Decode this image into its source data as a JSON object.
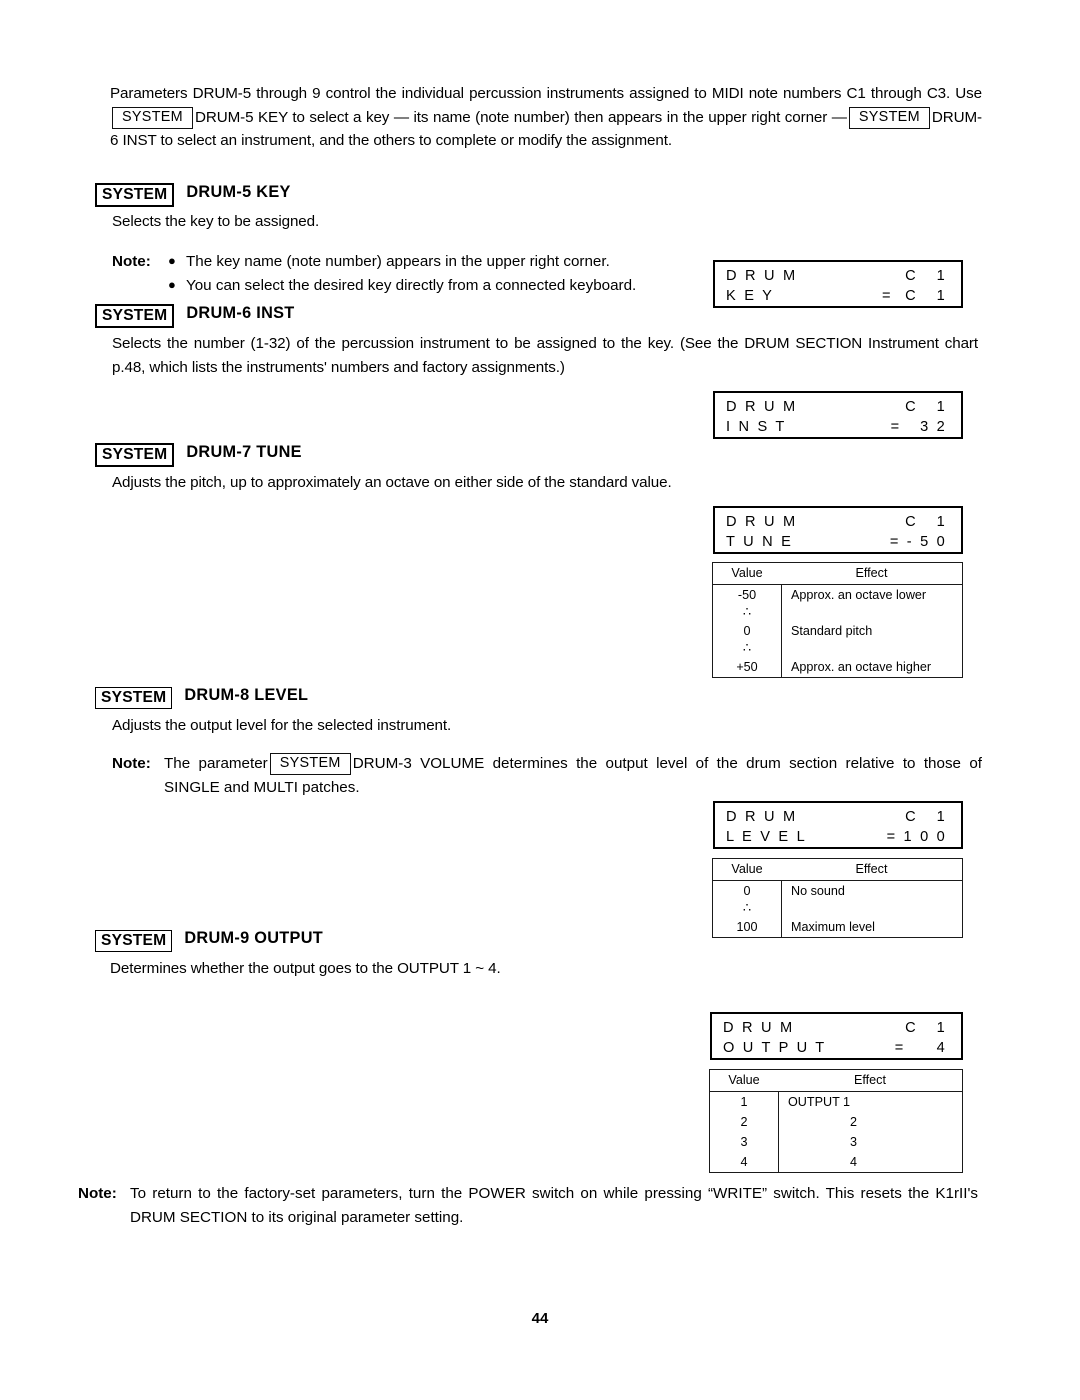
{
  "page": {
    "number": "44"
  },
  "intro": {
    "seg1": "Parameters DRUM-5 through 9 control the individual percussion instruments assigned to MIDI note numbers C1 through C3. Use",
    "sys1": "SYSTEM",
    "seg2": "DRUM-5 KEY to select a key — its name (note number) then appears in the upper right corner —",
    "sys2": "SYSTEM",
    "seg3": "DRUM-6 INST to select an instrument, and the others to complete or modify the assignment."
  },
  "sections": [
    {
      "key_label": "SYSTEM",
      "title": "DRUM-5 KEY",
      "body": "Selects the key to be assigned.",
      "note_label": "Note:",
      "bullets": [
        "The key name (note number) appears in the upper right corner.",
        "You can select the desired key directly from a connected keyboard."
      ],
      "lcd": {
        "line1_left": "D R U M",
        "line1_right": "C   1",
        "line2_left": "K E Y",
        "line2_right": "=  C   1"
      }
    },
    {
      "key_label": "SYSTEM",
      "title": "DRUM-6 INST",
      "body": "Selects the number (1-32) of the percussion instrument to be assigned to the key. (See the DRUM SECTION Instrument chart p.48, which lists the instruments' numbers and factory assignments.)",
      "lcd": {
        "line1_left": "D R U M",
        "line1_right": "C   1",
        "line2_left": "I N S T",
        "line2_right": "=   3 2"
      }
    },
    {
      "key_label": "SYSTEM",
      "title": "DRUM-7 TUNE",
      "body": "Adjusts the pitch, up to approximately an octave on either side of the standard value.",
      "lcd": {
        "line1_left": "D R U M",
        "line1_right": "C   1",
        "line2_left": "T U N E",
        "line2_right": "= - 5 0"
      },
      "table": {
        "headers": [
          "Value",
          "Effect"
        ],
        "rows": [
          {
            "value": "-50",
            "effect": "Approx. an octave lower",
            "cont": false
          },
          {
            "value": "∴",
            "effect": "",
            "cont": true
          },
          {
            "value": "0",
            "effect": "Standard pitch",
            "cont": false
          },
          {
            "value": "∴",
            "effect": "",
            "cont": true
          },
          {
            "value": "+50",
            "effect": "Approx. an octave higher",
            "cont": false
          }
        ]
      }
    },
    {
      "key_label": "SYSTEM",
      "title": "DRUM-8 LEVEL",
      "body": "Adjusts the output level for the selected instrument.",
      "note_label": "Note:",
      "note_seg1": "The parameter",
      "note_sys": "SYSTEM",
      "note_seg2": "DRUM-3 VOLUME determines the output level of the drum section relative to those of SINGLE and MULTI patches.",
      "lcd": {
        "line1_left": "D R U M",
        "line1_right": "C   1",
        "line2_left": "L E V E L",
        "line2_right": "= 1 0 0"
      },
      "table": {
        "headers": [
          "Value",
          "Effect"
        ],
        "rows": [
          {
            "value": "0",
            "effect": "No sound",
            "cont": false
          },
          {
            "value": "∴",
            "effect": "",
            "cont": true
          },
          {
            "value": "100",
            "effect": "Maximum level",
            "cont": false
          }
        ]
      }
    },
    {
      "key_label": "SYSTEM",
      "title": "DRUM-9 OUTPUT",
      "body": "Determines whether the output goes to the OUTPUT 1 ~ 4.",
      "lcd": {
        "line1_left": "D R U M",
        "line1_right": "C   1",
        "line2_left": "O U T P U T",
        "line2_right": "=     4"
      },
      "table": {
        "headers": [
          "Value",
          "Effect"
        ],
        "rows": [
          {
            "value": "1",
            "effect": "OUTPUT 1",
            "indent": false
          },
          {
            "value": "2",
            "effect": "2",
            "indent": true
          },
          {
            "value": "3",
            "effect": "3",
            "indent": true
          },
          {
            "value": "4",
            "effect": "4",
            "indent": true
          }
        ]
      }
    }
  ],
  "final_note": {
    "label": "Note:",
    "text": "To return to the factory-set parameters, turn the POWER switch on while pressing “WRITE” switch. This resets the K1rII's DRUM SECTION to its original parameter setting."
  }
}
